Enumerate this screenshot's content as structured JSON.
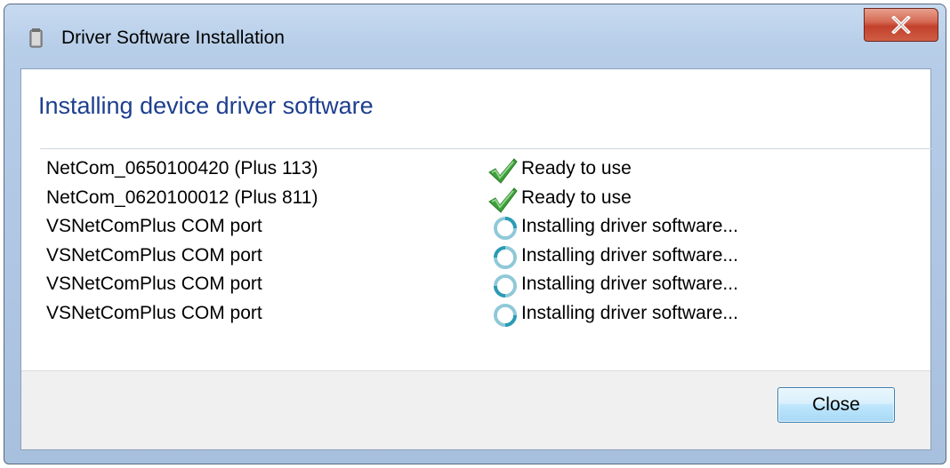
{
  "window": {
    "title": "Driver Software Installation"
  },
  "main": {
    "heading": "Installing device driver software",
    "devices": [
      {
        "name": "NetCom_0650100420 (Plus 113)",
        "status": "Ready to use",
        "status_icon": "checkmark-icon"
      },
      {
        "name": "NetCom_0620100012 (Plus 811)",
        "status": "Ready to use",
        "status_icon": "checkmark-icon"
      },
      {
        "name": "VSNetComPlus COM port",
        "status": "Installing driver software...",
        "status_icon": "busy-spinner-icon"
      },
      {
        "name": "VSNetComPlus COM port",
        "status": "Installing driver software...",
        "status_icon": "busy-spinner-icon"
      },
      {
        "name": "VSNetComPlus COM port",
        "status": "Installing driver software...",
        "status_icon": "busy-spinner-icon"
      },
      {
        "name": "VSNetComPlus COM port",
        "status": "Installing driver software...",
        "status_icon": "busy-spinner-icon"
      }
    ]
  },
  "footer": {
    "close_label": "Close"
  },
  "colors": {
    "heading": "#1e3f8f",
    "close_button_red": "#c2412c",
    "check_green": "#3ea03a",
    "spinner_teal": "#2a9bb4"
  }
}
